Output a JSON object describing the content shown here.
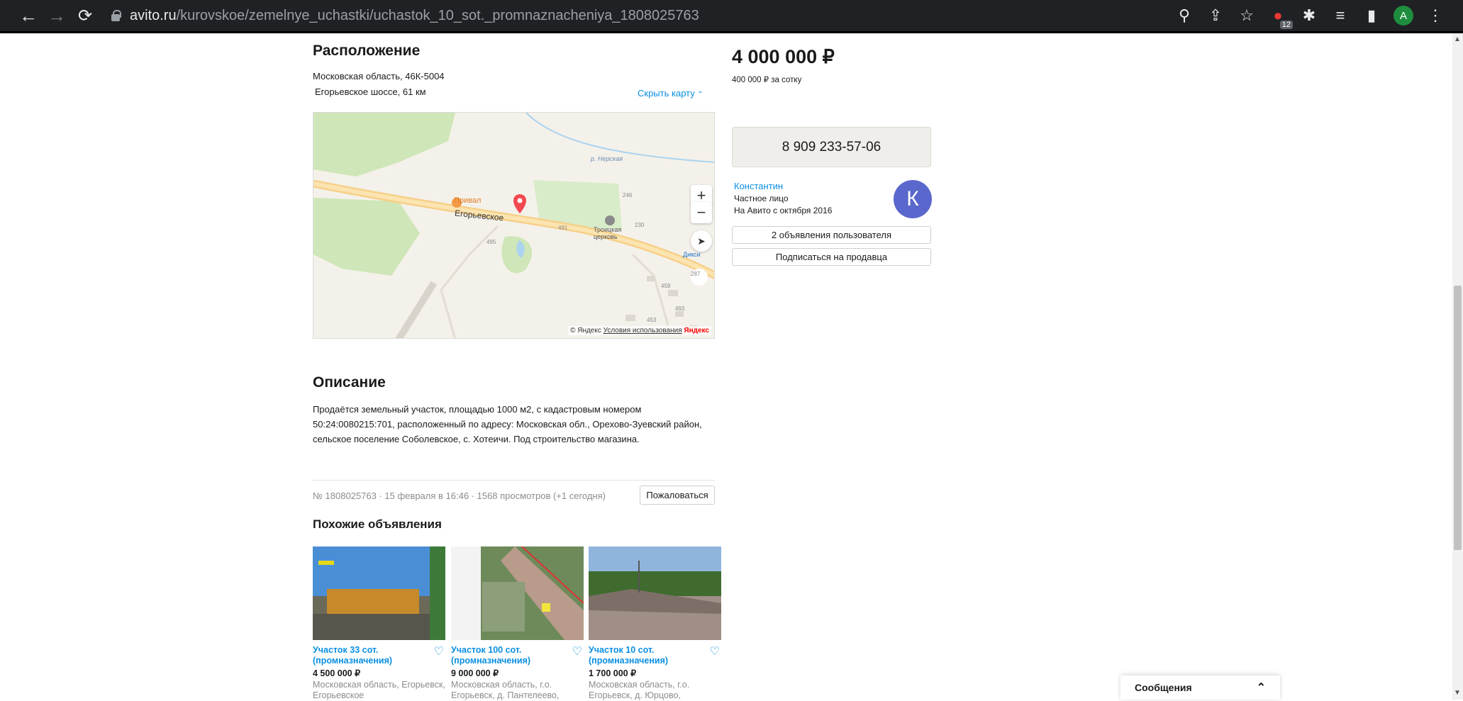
{
  "browser": {
    "url_host": "avito.ru",
    "url_path": "/kurovskoe/zemelnye_uchastki/uchastok_10_sot._promnaznacheniya_1808025763",
    "extension_badge": "12",
    "profile_initial": "A"
  },
  "location": {
    "heading": "Расположение",
    "address_line1": "Московская область, 46К-5004",
    "address_line2": "Егорьевское шоссе, 61 км",
    "hide_map": "Скрыть карту",
    "map_labels": {
      "river": "р. Нерская",
      "road": "Егорьевское",
      "poi_privál": "Привал",
      "church": "Троицкая церковь",
      "shop": "Дикси",
      "house_491": "491",
      "house_495": "495",
      "house_246": "246",
      "house_230": "230",
      "house_459": "459",
      "house_493": "493",
      "house_453": "453",
      "house_287": "287"
    },
    "map_copyright": "© Яндекс",
    "map_terms": "Условия использования",
    "map_brand": "Яндекс"
  },
  "description": {
    "heading": "Описание",
    "text": "Продаётся земельный участок, площадью 1000 м2, с кадастровым номером 50:24:0080215:701, расположенный по адресу: Московская обл., Орехово-Зуевский район, сельское поселение Соболевское, с. Хотеичи. Под строительство магазина."
  },
  "meta": {
    "info": "№ 1808025763 · 15 февраля в 16:46 · 1568 просмотров (+1 сегодня)",
    "complain_label": "Пожаловаться"
  },
  "price": {
    "main": "4 000 000 ₽",
    "per_unit": "400 000 ₽ за сотку"
  },
  "seller": {
    "phone": "8 909 233-57-06",
    "name": "Константин",
    "type": "Частное лицо",
    "since": "На Авито с октября 2016",
    "avatar_letter": "К",
    "ads_button": "2 объявления пользователя",
    "subscribe_button": "Подписаться на продавца"
  },
  "similar": {
    "heading": "Похожие объявления",
    "items": [
      {
        "title": "Участок 33 сот. (промназначения)",
        "price": "4 500 000 ₽",
        "address": "Московская область, Егорьевск, Егорьевское"
      },
      {
        "title": "Участок 100 сот. (промназначения)",
        "price": "9 000 000 ₽",
        "address": "Московская область, г.о. Егорьевск, д. Пантелеево,"
      },
      {
        "title": "Участок 10 сот. (промназначения)",
        "price": "1 700 000 ₽",
        "address": "Московская область, г.о. Егорьевск, д. Юрцово,"
      }
    ]
  },
  "messages": {
    "label": "Сообщения"
  },
  "colors": {
    "link": "#0a8fe1",
    "avatar": "#5a67cc",
    "phone_button": "#f0eeea"
  }
}
